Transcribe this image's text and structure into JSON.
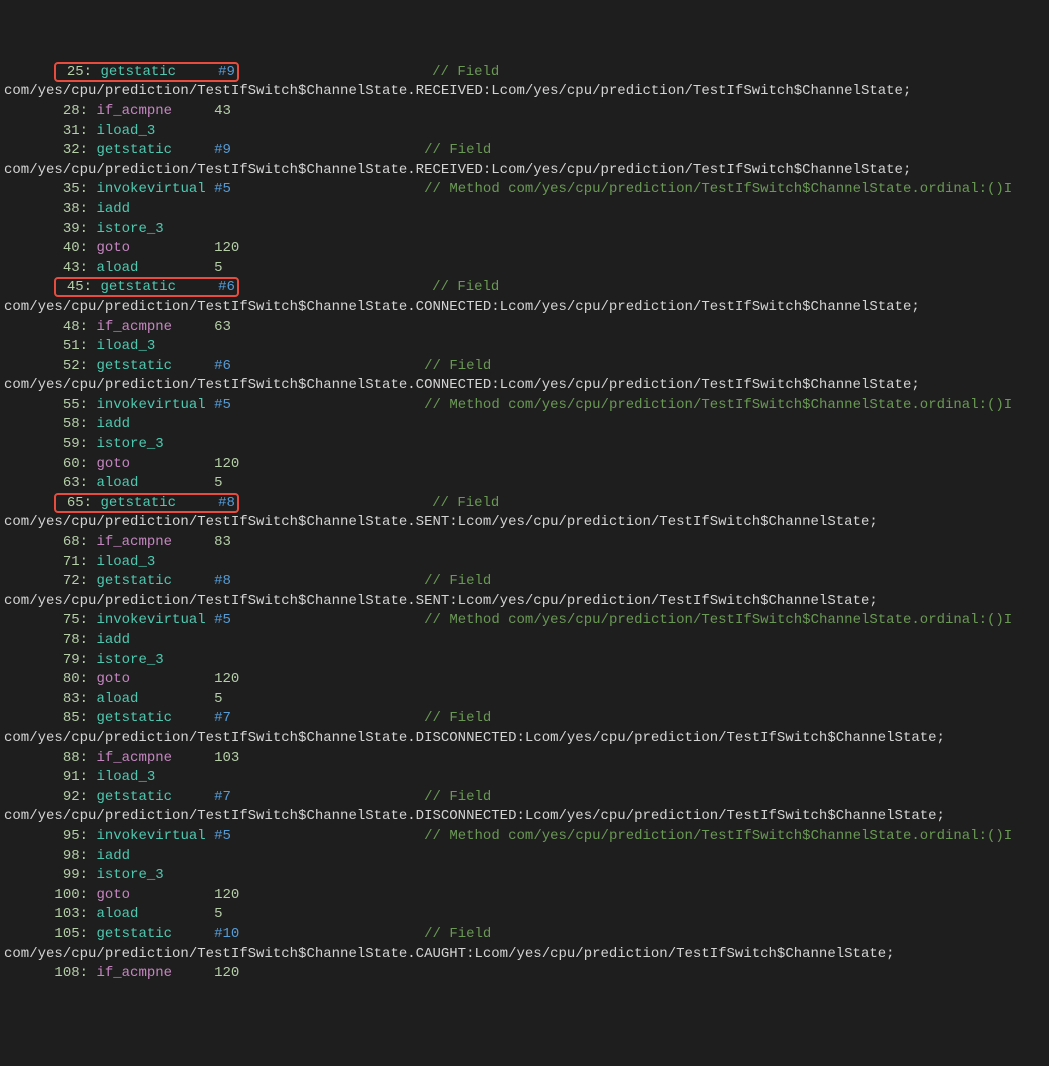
{
  "lines": [
    {
      "offset": "25",
      "op": "getstatic",
      "opClass": "opcode",
      "arg": "#9",
      "argClass": "arg",
      "comment": "// Field",
      "highlighted": true,
      "cont": "com/yes/cpu/prediction/TestIfSwitch$ChannelState.RECEIVED:Lcom/yes/cpu/prediction/TestIfSwitch$ChannelState;"
    },
    {
      "offset": "28",
      "op": "if_acmpne",
      "opClass": "opcode-branch",
      "arg": "43",
      "argClass": "num"
    },
    {
      "offset": "31",
      "op": "iload_3",
      "opClass": "opcode"
    },
    {
      "offset": "32",
      "op": "getstatic",
      "opClass": "opcode",
      "arg": "#9",
      "argClass": "arg",
      "comment": "// Field",
      "cont": "com/yes/cpu/prediction/TestIfSwitch$ChannelState.RECEIVED:Lcom/yes/cpu/prediction/TestIfSwitch$ChannelState;"
    },
    {
      "offset": "35",
      "op": "invokevirtual",
      "opClass": "opcode",
      "arg": "#5",
      "argClass": "arg",
      "comment": "// Method com/yes/cpu/prediction/TestIfSwitch$ChannelState.ordinal:()I"
    },
    {
      "offset": "38",
      "op": "iadd",
      "opClass": "opcode"
    },
    {
      "offset": "39",
      "op": "istore_3",
      "opClass": "opcode"
    },
    {
      "offset": "40",
      "op": "goto",
      "opClass": "opcode-branch",
      "arg": "120",
      "argClass": "num"
    },
    {
      "offset": "43",
      "op": "aload",
      "opClass": "opcode",
      "arg": "5",
      "argClass": "num"
    },
    {
      "offset": "45",
      "op": "getstatic",
      "opClass": "opcode",
      "arg": "#6",
      "argClass": "arg",
      "comment": "// Field",
      "highlighted": true,
      "cont": "com/yes/cpu/prediction/TestIfSwitch$ChannelState.CONNECTED:Lcom/yes/cpu/prediction/TestIfSwitch$ChannelState;"
    },
    {
      "offset": "48",
      "op": "if_acmpne",
      "opClass": "opcode-branch",
      "arg": "63",
      "argClass": "num"
    },
    {
      "offset": "51",
      "op": "iload_3",
      "opClass": "opcode"
    },
    {
      "offset": "52",
      "op": "getstatic",
      "opClass": "opcode",
      "arg": "#6",
      "argClass": "arg",
      "comment": "// Field",
      "cont": "com/yes/cpu/prediction/TestIfSwitch$ChannelState.CONNECTED:Lcom/yes/cpu/prediction/TestIfSwitch$ChannelState;"
    },
    {
      "offset": "55",
      "op": "invokevirtual",
      "opClass": "opcode",
      "arg": "#5",
      "argClass": "arg",
      "comment": "// Method com/yes/cpu/prediction/TestIfSwitch$ChannelState.ordinal:()I"
    },
    {
      "offset": "58",
      "op": "iadd",
      "opClass": "opcode"
    },
    {
      "offset": "59",
      "op": "istore_3",
      "opClass": "opcode"
    },
    {
      "offset": "60",
      "op": "goto",
      "opClass": "opcode-branch",
      "arg": "120",
      "argClass": "num"
    },
    {
      "offset": "63",
      "op": "aload",
      "opClass": "opcode",
      "arg": "5",
      "argClass": "num"
    },
    {
      "offset": "65",
      "op": "getstatic",
      "opClass": "opcode",
      "arg": "#8",
      "argClass": "arg",
      "comment": "// Field",
      "highlighted": true,
      "cont": "com/yes/cpu/prediction/TestIfSwitch$ChannelState.SENT:Lcom/yes/cpu/prediction/TestIfSwitch$ChannelState;"
    },
    {
      "offset": "68",
      "op": "if_acmpne",
      "opClass": "opcode-branch",
      "arg": "83",
      "argClass": "num"
    },
    {
      "offset": "71",
      "op": "iload_3",
      "opClass": "opcode"
    },
    {
      "offset": "72",
      "op": "getstatic",
      "opClass": "opcode",
      "arg": "#8",
      "argClass": "arg",
      "comment": "// Field",
      "cont": "com/yes/cpu/prediction/TestIfSwitch$ChannelState.SENT:Lcom/yes/cpu/prediction/TestIfSwitch$ChannelState;"
    },
    {
      "offset": "75",
      "op": "invokevirtual",
      "opClass": "opcode",
      "arg": "#5",
      "argClass": "arg",
      "comment": "// Method com/yes/cpu/prediction/TestIfSwitch$ChannelState.ordinal:()I"
    },
    {
      "offset": "78",
      "op": "iadd",
      "opClass": "opcode"
    },
    {
      "offset": "79",
      "op": "istore_3",
      "opClass": "opcode"
    },
    {
      "offset": "80",
      "op": "goto",
      "opClass": "opcode-branch",
      "arg": "120",
      "argClass": "num"
    },
    {
      "offset": "83",
      "op": "aload",
      "opClass": "opcode",
      "arg": "5",
      "argClass": "num"
    },
    {
      "offset": "85",
      "op": "getstatic",
      "opClass": "opcode",
      "arg": "#7",
      "argClass": "arg",
      "comment": "// Field",
      "cont": "com/yes/cpu/prediction/TestIfSwitch$ChannelState.DISCONNECTED:Lcom/yes/cpu/prediction/TestIfSwitch$ChannelState;"
    },
    {
      "offset": "88",
      "op": "if_acmpne",
      "opClass": "opcode-branch",
      "arg": "103",
      "argClass": "num"
    },
    {
      "offset": "91",
      "op": "iload_3",
      "opClass": "opcode"
    },
    {
      "offset": "92",
      "op": "getstatic",
      "opClass": "opcode",
      "arg": "#7",
      "argClass": "arg",
      "comment": "// Field",
      "cont": "com/yes/cpu/prediction/TestIfSwitch$ChannelState.DISCONNECTED:Lcom/yes/cpu/prediction/TestIfSwitch$ChannelState;"
    },
    {
      "offset": "95",
      "op": "invokevirtual",
      "opClass": "opcode",
      "arg": "#5",
      "argClass": "arg",
      "comment": "// Method com/yes/cpu/prediction/TestIfSwitch$ChannelState.ordinal:()I"
    },
    {
      "offset": "98",
      "op": "iadd",
      "opClass": "opcode"
    },
    {
      "offset": "99",
      "op": "istore_3",
      "opClass": "opcode"
    },
    {
      "offset": "100",
      "op": "goto",
      "opClass": "opcode-branch",
      "arg": "120",
      "argClass": "num"
    },
    {
      "offset": "103",
      "op": "aload",
      "opClass": "opcode",
      "arg": "5",
      "argClass": "num"
    },
    {
      "offset": "105",
      "op": "getstatic",
      "opClass": "opcode",
      "arg": "#10",
      "argClass": "arg",
      "comment": "// Field",
      "cont": "com/yes/cpu/prediction/TestIfSwitch$ChannelState.CAUGHT:Lcom/yes/cpu/prediction/TestIfSwitch$ChannelState;"
    },
    {
      "offset": "108",
      "op": "if_acmpne",
      "opClass": "opcode-branch",
      "arg": "120",
      "argClass": "num"
    }
  ]
}
